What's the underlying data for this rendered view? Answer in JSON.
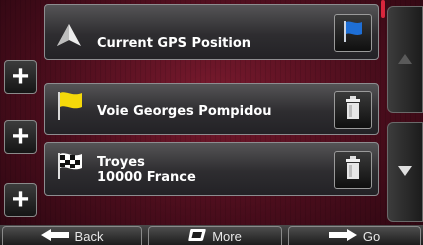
{
  "waypoints": [
    {
      "label_line1": "Current GPS Position",
      "label_line2": "",
      "icon": "navigation-arrow-icon",
      "action_icon": "blue-flag-icon"
    },
    {
      "label_line1": "Voie Georges Pompidou",
      "label_line2": "",
      "icon": "yellow-flag-icon",
      "action_icon": "trash-icon"
    },
    {
      "label_line1": "Troyes",
      "label_line2": "10000 France",
      "icon": "checkered-flag-icon",
      "action_icon": "trash-icon"
    }
  ],
  "add_buttons": [
    "+",
    "+",
    "+"
  ],
  "bottom_bar": {
    "back_label": "Back",
    "more_label": "More",
    "go_label": "Go"
  },
  "colors": {
    "background": "#4a0d1c",
    "flag_blue": "#1e6fd6",
    "flag_yellow": "#f5d90a",
    "scroll_marker": "#d9263c"
  }
}
